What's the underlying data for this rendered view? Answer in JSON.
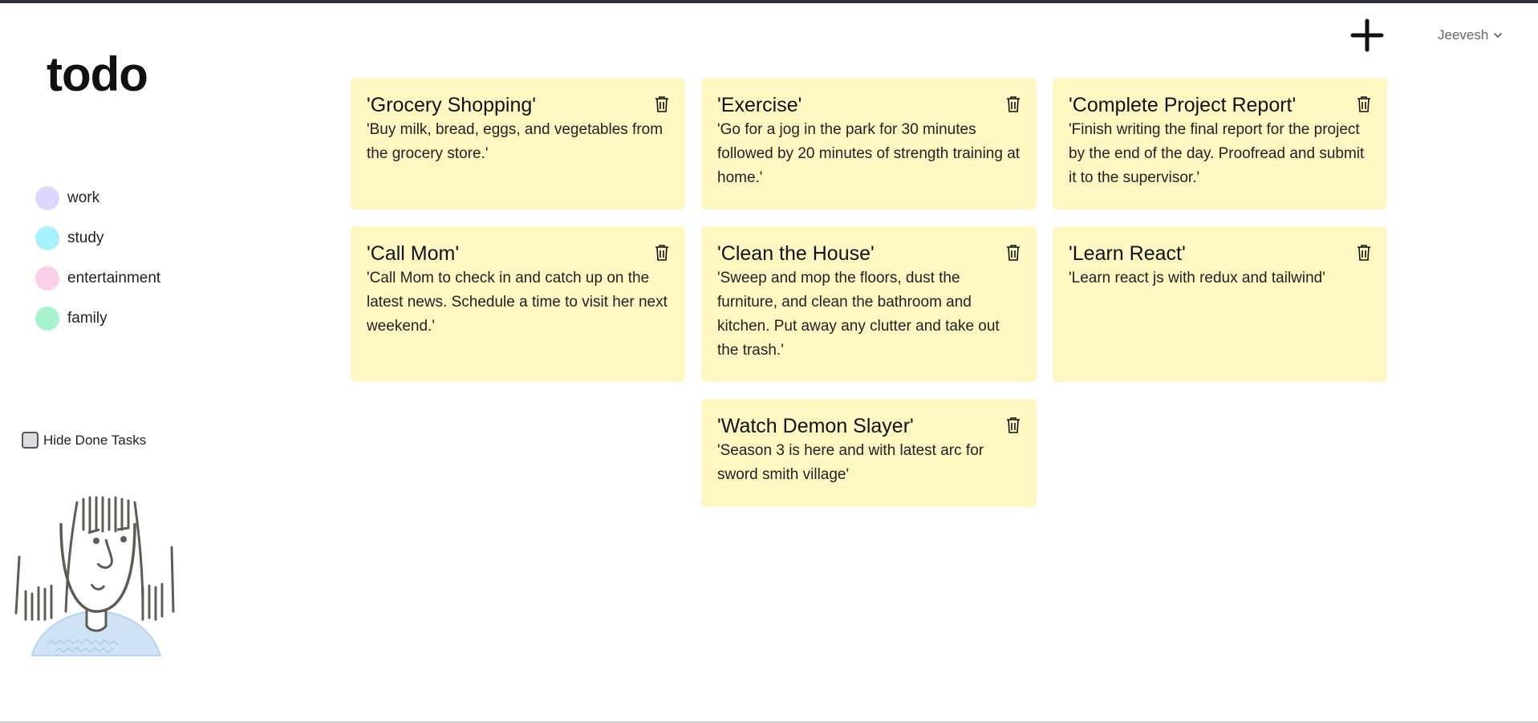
{
  "app": {
    "title": "todo"
  },
  "header": {
    "add_icon": "plus-icon",
    "user_name": "Jeevesh",
    "user_menu_icon": "chevron-down-icon"
  },
  "sidebar": {
    "categories": [
      {
        "label": "work",
        "color": "#ddd6fe"
      },
      {
        "label": "study",
        "color": "#a5f3fc"
      },
      {
        "label": "entertainment",
        "color": "#fbcfe8"
      },
      {
        "label": "family",
        "color": "#a7f3d0"
      }
    ],
    "hide_done_label": "Hide Done Tasks",
    "hide_done_checked": false
  },
  "colors": {
    "card_background": "#fef7c2",
    "topline": "#2b2f36"
  },
  "todos": [
    {
      "title": "'Grocery Shopping'",
      "description": "'Buy milk, bread, eggs, and vegetables from the grocery store.'"
    },
    {
      "title": "'Exercise'",
      "description": "'Go for a jog in the park for 30 minutes followed by 20 minutes of strength training at home.'"
    },
    {
      "title": "'Complete Project Report'",
      "description": "'Finish writing the final report for the project by the end of the day. Proofread and submit it to the supervisor.'"
    },
    {
      "title": "'Call Mom'",
      "description": "'Call Mom to check in and catch up on the latest news. Schedule a time to visit her next weekend.'"
    },
    {
      "title": "'Clean the House'",
      "description": "'Sweep and mop the floors, dust the furniture, and clean the bathroom and kitchen. Put away any clutter and take out the trash.'"
    },
    {
      "title": "'Learn React'",
      "description": "'Learn react js with redux and tailwind'"
    },
    {
      "title": "'Watch Demon Slayer'",
      "description": "'Season 3 is here and with latest arc for sword smith village'"
    }
  ]
}
